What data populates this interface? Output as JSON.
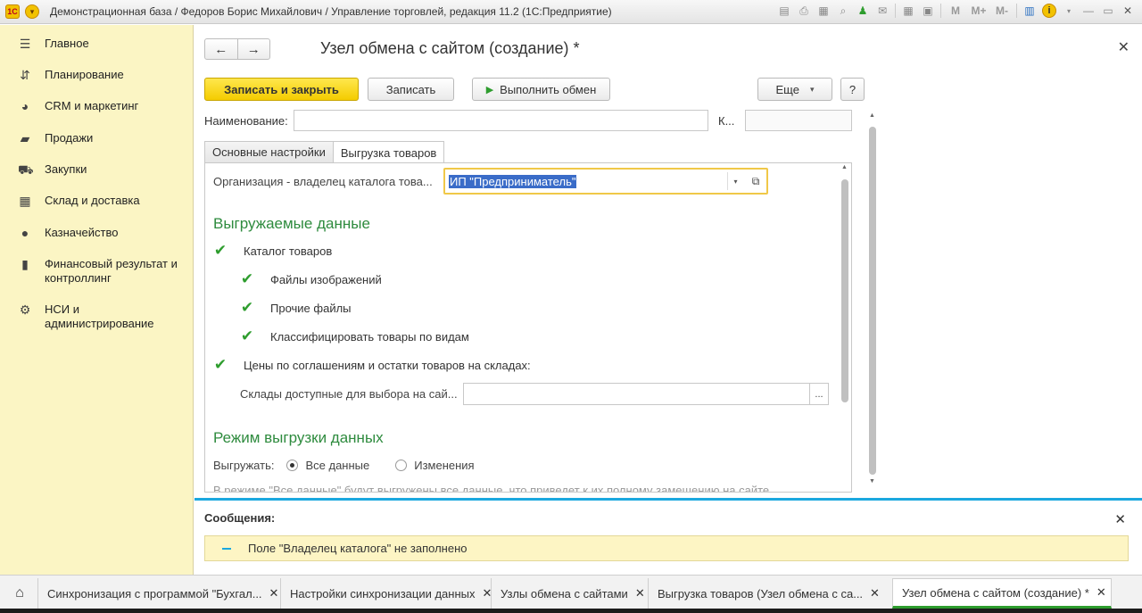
{
  "window": {
    "title": "Демонстрационная база / Федоров Борис Михайлович / Управление торговлей, редакция 11.2  (1С:Предприятие)",
    "logo_text": "1С",
    "toolbar_m": [
      "M",
      "M+",
      "M-"
    ]
  },
  "sidebar": {
    "items": [
      {
        "label": "Главное",
        "icon": "menu-icon"
      },
      {
        "label": "Планирование",
        "icon": "planning-icon"
      },
      {
        "label": "CRM и маркетинг",
        "icon": "pie-chart-icon"
      },
      {
        "label": "Продажи",
        "icon": "bag-icon"
      },
      {
        "label": "Закупки",
        "icon": "cart-icon"
      },
      {
        "label": "Склад и доставка",
        "icon": "warehouse-icon"
      },
      {
        "label": "Казначейство",
        "icon": "ruble-icon"
      },
      {
        "label": "Финансовый результат и контроллинг",
        "icon": "bar-chart-icon"
      },
      {
        "label": "НСИ и администрирование",
        "icon": "gear-icon"
      }
    ]
  },
  "form": {
    "title": "Узел обмена с сайтом (создание) *",
    "buttons": {
      "save_close": "Записать и закрыть",
      "save": "Записать",
      "run_exchange": "Выполнить обмен",
      "more": "Еще",
      "help": "?"
    },
    "name_label": "Наименование:",
    "code_label": "К...",
    "name_value": "",
    "code_value": "",
    "tabs": [
      "Основные настройки",
      "Выгрузка товаров"
    ],
    "active_tab": 1,
    "org_label": "Организация - владелец каталога това...",
    "org_value": "ИП \"Предприниматель\"",
    "section_data": "Выгружаемые данные",
    "checks": [
      {
        "label": "Каталог товаров",
        "checked": true
      },
      {
        "label": "Файлы изображений",
        "checked": true
      },
      {
        "label": "Прочие файлы",
        "checked": true
      },
      {
        "label": "Классифицировать товары по видам",
        "checked": true
      },
      {
        "label": "Цены по соглашениям и остатки товаров на складах:",
        "checked": true
      }
    ],
    "warehouses_label": "Склады доступные для выбора на сай...",
    "warehouses_value": "",
    "section_mode": "Режим выгрузки данных",
    "export_label": "Выгружать:",
    "radio_all": "Все данные",
    "radio_changes": "Изменения",
    "radio_selected": "all",
    "note": "В режиме \"Все данные\" будут выгружены все данные, что приведет к их полному замещению на сайте"
  },
  "messages": {
    "title": "Сообщения:",
    "items": [
      "Поле \"Владелец каталога\" не заполнено"
    ]
  },
  "bottom_tabs": [
    {
      "label": "Синхронизация с программой \"Бухгал..."
    },
    {
      "label": "Настройки синхронизации данных"
    },
    {
      "label": "Узлы обмена с сайтами"
    },
    {
      "label": "Выгрузка товаров (Узел обмена с са..."
    },
    {
      "label": "Узел обмена с сайтом (создание) *"
    }
  ],
  "colors": {
    "sidebar_bg": "#fbf5c4",
    "primary_button": "#f4cc00",
    "section_heading": "#2e8b3e",
    "accent_blue": "#1ba8df",
    "check_green": "#2e9d2e"
  }
}
